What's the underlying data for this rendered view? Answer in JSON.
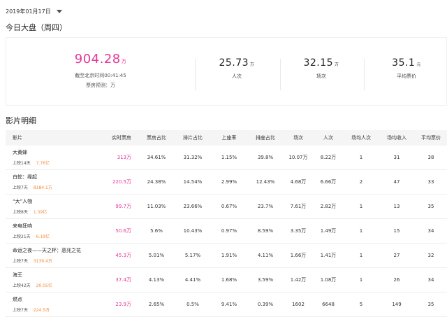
{
  "date_selector": {
    "label": "2019年01月17日"
  },
  "today_title": "今日大盘（周四）",
  "summary": {
    "box_office": "904.28",
    "box_office_unit": "万",
    "as_of": "截至北京时间00:41:45",
    "forecast": "票房预测：万",
    "stats": [
      {
        "value": "25.73",
        "unit": "万",
        "label": "人次"
      },
      {
        "value": "32.15",
        "unit": "万",
        "label": "场次"
      },
      {
        "value": "35.1",
        "unit": "元",
        "label": "平均票价"
      }
    ]
  },
  "detail_title": "影片明细",
  "table": {
    "headers": [
      "影片",
      "实时票房",
      "票房占比",
      "排片占比",
      "上座率",
      "排座占比",
      "场次",
      "人次",
      "场均人次",
      "场均收入",
      "平均票价"
    ],
    "rows": [
      {
        "name": "大黄蜂",
        "days": "上映14天",
        "total": "7.76亿",
        "cells": [
          "313万",
          "34.61%",
          "31.32%",
          "1.15%",
          "39.8%",
          "10.07万",
          "8.22万",
          "1",
          "31",
          "38"
        ]
      },
      {
        "name": "白蛇：缘起",
        "days": "上映7天",
        "total": "8184.1万",
        "cells": [
          "220.5万",
          "24.38%",
          "14.54%",
          "2.99%",
          "12.43%",
          "4.68万",
          "6.66万",
          "2",
          "47",
          "33"
        ]
      },
      {
        "name": "“大”人物",
        "days": "上映8天",
        "total": "1.39亿",
        "cells": [
          "99.7万",
          "11.03%",
          "23.66%",
          "0.67%",
          "23.7%",
          "7.61万",
          "2.82万",
          "1",
          "13",
          "35"
        ]
      },
      {
        "name": "来电狂响",
        "days": "上映21天",
        "total": "6.19亿",
        "cells": [
          "50.6万",
          "5.6%",
          "10.43%",
          "0.97%",
          "8.59%",
          "3.35万",
          "1.49万",
          "1",
          "15",
          "34"
        ]
      },
      {
        "name": "命运之夜——天之杯：恶兆之花",
        "days": "上映7天",
        "total": "3139.4万",
        "cells": [
          "45.3万",
          "5.01%",
          "5.17%",
          "1.91%",
          "4.11%",
          "1.66万",
          "1.41万",
          "1",
          "27",
          "32"
        ]
      },
      {
        "name": "海王",
        "days": "上映42天",
        "total": "20.05亿",
        "cells": [
          "37.4万",
          "4.13%",
          "4.41%",
          "1.68%",
          "3.59%",
          "1.42万",
          "1.08万",
          "1",
          "26",
          "34"
        ]
      },
      {
        "name": "燃点",
        "days": "上映7天",
        "total": "224.5万",
        "cells": [
          "23.9万",
          "2.65%",
          "0.5%",
          "9.41%",
          "0.39%",
          "1602",
          "6648",
          "5",
          "149",
          "35"
        ]
      }
    ]
  }
}
